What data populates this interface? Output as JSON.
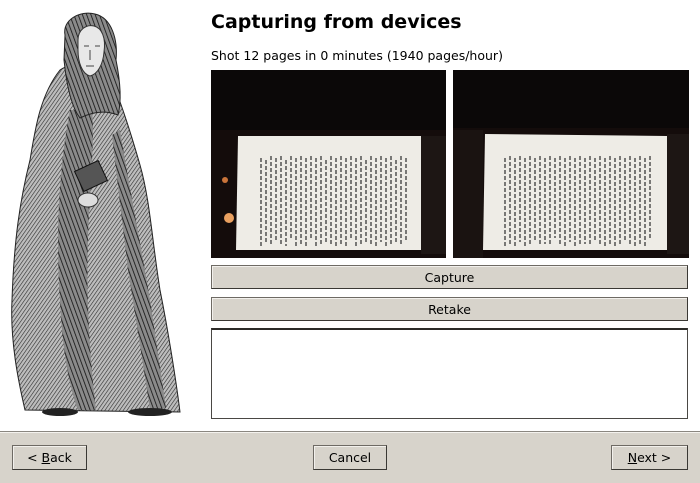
{
  "page": {
    "title": "Capturing from devices",
    "status": "Shot 12 pages in 0 minutes (1940 pages/hour)"
  },
  "previews": [
    {
      "name": "left-page-preview",
      "icon": "captured-page-image"
    },
    {
      "name": "right-page-preview",
      "icon": "captured-page-image"
    }
  ],
  "actions": {
    "capture_label": "Capture",
    "retake_label": "Retake"
  },
  "log": {
    "value": ""
  },
  "footer": {
    "back_prefix": "< ",
    "back_mnemonic": "B",
    "back_rest": "ack",
    "cancel_label": "Cancel",
    "next_mnemonic": "N",
    "next_rest": "ext >"
  },
  "colors": {
    "button_face": "#d7d3cb",
    "preview_background": "#140c0b",
    "page_paper": "#eeece6"
  }
}
